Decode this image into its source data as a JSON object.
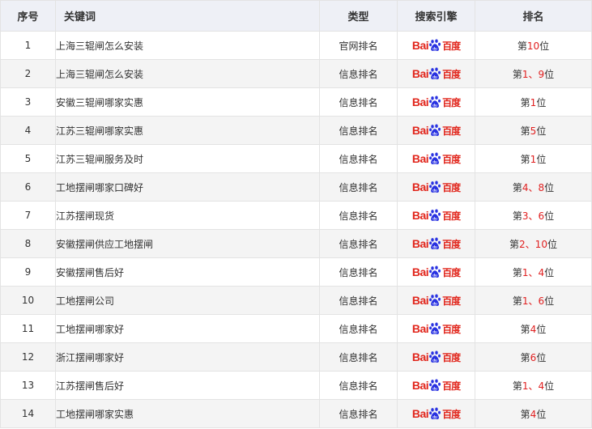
{
  "headers": {
    "index": "序号",
    "keyword": "关键词",
    "type": "类型",
    "engine": "搜索引擎",
    "rank": "排名"
  },
  "engine_logo": {
    "text_left": "Bai",
    "text_right": "百度",
    "icon": "paw-icon",
    "color": "#e1251b"
  },
  "rank_color": "#e02020",
  "rows": [
    {
      "index": "1",
      "keyword": "上海三辊闸怎么安装",
      "type": "官网排名",
      "rank_prefix": "第",
      "rank_value": "10",
      "rank_suffix": "位"
    },
    {
      "index": "2",
      "keyword": "上海三辊闸怎么安装",
      "type": "信息排名",
      "rank_prefix": "第",
      "rank_value": "1、9",
      "rank_suffix": "位"
    },
    {
      "index": "3",
      "keyword": "安徽三辊闸哪家实惠",
      "type": "信息排名",
      "rank_prefix": "第",
      "rank_value": "1",
      "rank_suffix": "位"
    },
    {
      "index": "4",
      "keyword": "江苏三辊闸哪家实惠",
      "type": "信息排名",
      "rank_prefix": "第",
      "rank_value": "5",
      "rank_suffix": "位"
    },
    {
      "index": "5",
      "keyword": "江苏三辊闸服务及时",
      "type": "信息排名",
      "rank_prefix": "第",
      "rank_value": "1",
      "rank_suffix": "位"
    },
    {
      "index": "6",
      "keyword": "工地摆闸哪家口碑好",
      "type": "信息排名",
      "rank_prefix": "第",
      "rank_value": "4、8",
      "rank_suffix": "位"
    },
    {
      "index": "7",
      "keyword": "江苏摆闸现货",
      "type": "信息排名",
      "rank_prefix": "第",
      "rank_value": "3、6",
      "rank_suffix": "位"
    },
    {
      "index": "8",
      "keyword": "安徽摆闸供应工地摆闸",
      "type": "信息排名",
      "rank_prefix": "第",
      "rank_value": "2、10",
      "rank_suffix": "位"
    },
    {
      "index": "9",
      "keyword": "安徽摆闸售后好",
      "type": "信息排名",
      "rank_prefix": "第",
      "rank_value": "1、4",
      "rank_suffix": "位"
    },
    {
      "index": "10",
      "keyword": "工地摆闸公司",
      "type": "信息排名",
      "rank_prefix": "第",
      "rank_value": "1、6",
      "rank_suffix": "位"
    },
    {
      "index": "11",
      "keyword": "工地摆闸哪家好",
      "type": "信息排名",
      "rank_prefix": "第",
      "rank_value": "4",
      "rank_suffix": "位"
    },
    {
      "index": "12",
      "keyword": "浙江摆闸哪家好",
      "type": "信息排名",
      "rank_prefix": "第",
      "rank_value": "6",
      "rank_suffix": "位"
    },
    {
      "index": "13",
      "keyword": "江苏摆闸售后好",
      "type": "信息排名",
      "rank_prefix": "第",
      "rank_value": "1、4",
      "rank_suffix": "位"
    },
    {
      "index": "14",
      "keyword": "工地摆闸哪家实惠",
      "type": "信息排名",
      "rank_prefix": "第",
      "rank_value": "4",
      "rank_suffix": "位"
    }
  ]
}
